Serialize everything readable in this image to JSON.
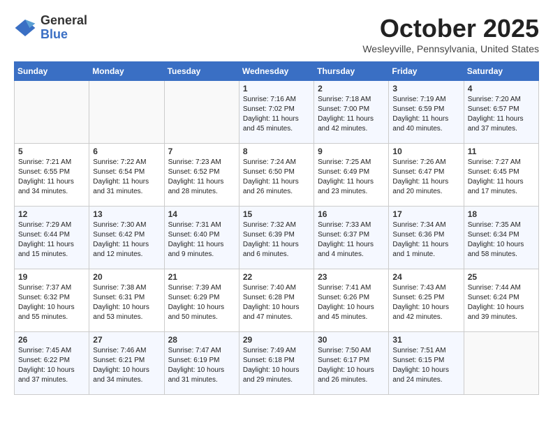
{
  "logo": {
    "general": "General",
    "blue": "Blue"
  },
  "title": "October 2025",
  "location": "Wesleyville, Pennsylvania, United States",
  "days_of_week": [
    "Sunday",
    "Monday",
    "Tuesday",
    "Wednesday",
    "Thursday",
    "Friday",
    "Saturday"
  ],
  "weeks": [
    [
      {
        "day": "",
        "info": ""
      },
      {
        "day": "",
        "info": ""
      },
      {
        "day": "",
        "info": ""
      },
      {
        "day": "1",
        "info": "Sunrise: 7:16 AM\nSunset: 7:02 PM\nDaylight: 11 hours and 45 minutes."
      },
      {
        "day": "2",
        "info": "Sunrise: 7:18 AM\nSunset: 7:00 PM\nDaylight: 11 hours and 42 minutes."
      },
      {
        "day": "3",
        "info": "Sunrise: 7:19 AM\nSunset: 6:59 PM\nDaylight: 11 hours and 40 minutes."
      },
      {
        "day": "4",
        "info": "Sunrise: 7:20 AM\nSunset: 6:57 PM\nDaylight: 11 hours and 37 minutes."
      }
    ],
    [
      {
        "day": "5",
        "info": "Sunrise: 7:21 AM\nSunset: 6:55 PM\nDaylight: 11 hours and 34 minutes."
      },
      {
        "day": "6",
        "info": "Sunrise: 7:22 AM\nSunset: 6:54 PM\nDaylight: 11 hours and 31 minutes."
      },
      {
        "day": "7",
        "info": "Sunrise: 7:23 AM\nSunset: 6:52 PM\nDaylight: 11 hours and 28 minutes."
      },
      {
        "day": "8",
        "info": "Sunrise: 7:24 AM\nSunset: 6:50 PM\nDaylight: 11 hours and 26 minutes."
      },
      {
        "day": "9",
        "info": "Sunrise: 7:25 AM\nSunset: 6:49 PM\nDaylight: 11 hours and 23 minutes."
      },
      {
        "day": "10",
        "info": "Sunrise: 7:26 AM\nSunset: 6:47 PM\nDaylight: 11 hours and 20 minutes."
      },
      {
        "day": "11",
        "info": "Sunrise: 7:27 AM\nSunset: 6:45 PM\nDaylight: 11 hours and 17 minutes."
      }
    ],
    [
      {
        "day": "12",
        "info": "Sunrise: 7:29 AM\nSunset: 6:44 PM\nDaylight: 11 hours and 15 minutes."
      },
      {
        "day": "13",
        "info": "Sunrise: 7:30 AM\nSunset: 6:42 PM\nDaylight: 11 hours and 12 minutes."
      },
      {
        "day": "14",
        "info": "Sunrise: 7:31 AM\nSunset: 6:40 PM\nDaylight: 11 hours and 9 minutes."
      },
      {
        "day": "15",
        "info": "Sunrise: 7:32 AM\nSunset: 6:39 PM\nDaylight: 11 hours and 6 minutes."
      },
      {
        "day": "16",
        "info": "Sunrise: 7:33 AM\nSunset: 6:37 PM\nDaylight: 11 hours and 4 minutes."
      },
      {
        "day": "17",
        "info": "Sunrise: 7:34 AM\nSunset: 6:36 PM\nDaylight: 11 hours and 1 minute."
      },
      {
        "day": "18",
        "info": "Sunrise: 7:35 AM\nSunset: 6:34 PM\nDaylight: 10 hours and 58 minutes."
      }
    ],
    [
      {
        "day": "19",
        "info": "Sunrise: 7:37 AM\nSunset: 6:32 PM\nDaylight: 10 hours and 55 minutes."
      },
      {
        "day": "20",
        "info": "Sunrise: 7:38 AM\nSunset: 6:31 PM\nDaylight: 10 hours and 53 minutes."
      },
      {
        "day": "21",
        "info": "Sunrise: 7:39 AM\nSunset: 6:29 PM\nDaylight: 10 hours and 50 minutes."
      },
      {
        "day": "22",
        "info": "Sunrise: 7:40 AM\nSunset: 6:28 PM\nDaylight: 10 hours and 47 minutes."
      },
      {
        "day": "23",
        "info": "Sunrise: 7:41 AM\nSunset: 6:26 PM\nDaylight: 10 hours and 45 minutes."
      },
      {
        "day": "24",
        "info": "Sunrise: 7:43 AM\nSunset: 6:25 PM\nDaylight: 10 hours and 42 minutes."
      },
      {
        "day": "25",
        "info": "Sunrise: 7:44 AM\nSunset: 6:24 PM\nDaylight: 10 hours and 39 minutes."
      }
    ],
    [
      {
        "day": "26",
        "info": "Sunrise: 7:45 AM\nSunset: 6:22 PM\nDaylight: 10 hours and 37 minutes."
      },
      {
        "day": "27",
        "info": "Sunrise: 7:46 AM\nSunset: 6:21 PM\nDaylight: 10 hours and 34 minutes."
      },
      {
        "day": "28",
        "info": "Sunrise: 7:47 AM\nSunset: 6:19 PM\nDaylight: 10 hours and 31 minutes."
      },
      {
        "day": "29",
        "info": "Sunrise: 7:49 AM\nSunset: 6:18 PM\nDaylight: 10 hours and 29 minutes."
      },
      {
        "day": "30",
        "info": "Sunrise: 7:50 AM\nSunset: 6:17 PM\nDaylight: 10 hours and 26 minutes."
      },
      {
        "day": "31",
        "info": "Sunrise: 7:51 AM\nSunset: 6:15 PM\nDaylight: 10 hours and 24 minutes."
      },
      {
        "day": "",
        "info": ""
      }
    ]
  ]
}
